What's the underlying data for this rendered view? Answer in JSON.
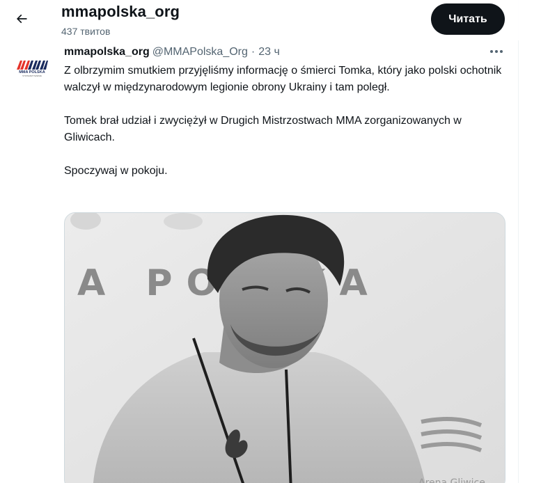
{
  "header": {
    "title": "mmapolska_org",
    "tweet_count": "437 твитов",
    "follow_label": "Читать"
  },
  "tweet": {
    "display_name": "mmapolska_org",
    "handle": "@MMAPolska_Org",
    "separator": "·",
    "time": "23 ч",
    "paragraphs": [
      "Z olbrzymim smutkiem przyjęliśmy informację o śmierci Tomka, który jako polski ochotnik walczył w międzynarodowym legionie obrony Ukrainy i tam poległ.",
      "Tomek brał udział i zwyciężył w Drugich Mistrzostwach MMA zorganizowanych w Gliwicach.",
      "Spoczywaj w pokoju."
    ],
    "avatar": {
      "logo_text": "MMA POLSKA",
      "logo_subtext": "STOWARZYSZENIE"
    },
    "media": {
      "banner_text": "A PO  SKA",
      "arena_text": "Arena Gliwice"
    }
  },
  "icons": {
    "back": "arrow-left-icon",
    "more": "more-horizontal-icon"
  },
  "colors": {
    "text_primary": "#0f1419",
    "text_secondary": "#536471",
    "button_bg": "#0f1419",
    "border": "#cfd9de"
  }
}
